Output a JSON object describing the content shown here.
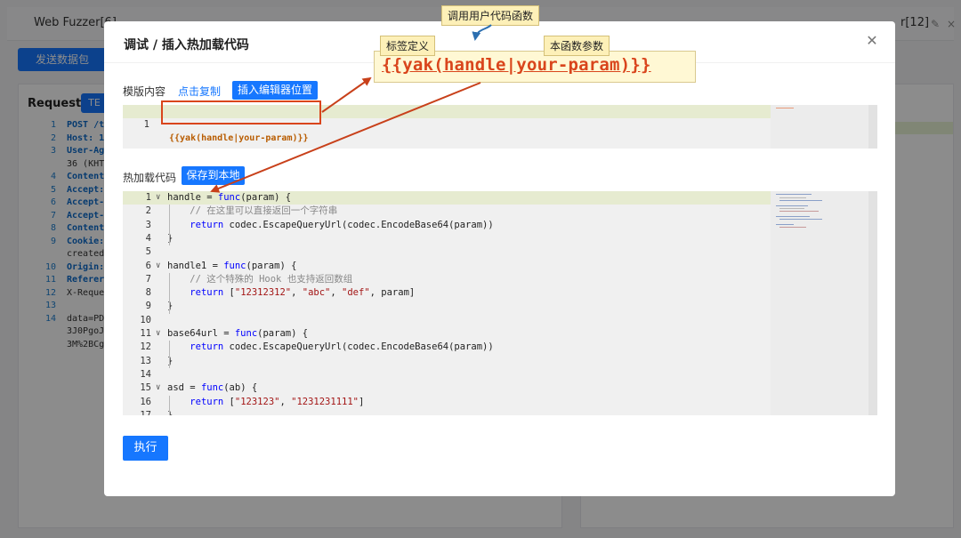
{
  "background": {
    "tabs": [
      {
        "label": "Web Fuzzer[6]"
      },
      {
        "label": "r[12]"
      }
    ],
    "send_button": "发送数据包",
    "request_label": "Request",
    "request_tab": "TE",
    "request_lines": [
      {
        "n": "1",
        "t": "POST /t",
        "kw": true
      },
      {
        "n": "2",
        "t": "Host: 1",
        "kw": true
      },
      {
        "n": "3",
        "t": "User-Ag",
        "kw": true
      },
      {
        "n": "",
        "t": "36 (KHT",
        "kw": false
      },
      {
        "n": "4",
        "t": "Content",
        "kw": true
      },
      {
        "n": "5",
        "t": "Accept:",
        "kw": true
      },
      {
        "n": "6",
        "t": "Accept-",
        "kw": true
      },
      {
        "n": "7",
        "t": "Accept-",
        "kw": true
      },
      {
        "n": "8",
        "t": "Content",
        "kw": true
      },
      {
        "n": "9",
        "t": "Cookie:",
        "kw": true
      },
      {
        "n": "",
        "t": "created",
        "kw": false
      },
      {
        "n": "10",
        "t": "Origin:",
        "kw": true
      },
      {
        "n": "11",
        "t": "Referer",
        "kw": true
      },
      {
        "n": "12",
        "t": "X-Reque",
        "kw": false
      },
      {
        "n": "13",
        "t": "",
        "kw": false
      },
      {
        "n": "14",
        "t": "data=PD",
        "kw": false
      },
      {
        "n": "",
        "t": "3J0PgoJ",
        "kw": false
      },
      {
        "n": "",
        "t": "3M%2BCg",
        "kw": false
      }
    ]
  },
  "modal": {
    "title": "调试 / 插入热加载代码",
    "template_label": "模版内容",
    "copy_link": "点击复制",
    "insert_button": "插入编辑器位置",
    "template_code": "{{yak(handle|your-param)}}",
    "template_line_no": "1",
    "hot_label": "热加载代码",
    "save_button": "保存到本地",
    "run_button": "执行",
    "close_symbol": "✕",
    "code_lines": [
      {
        "n": "1",
        "fold": true,
        "parts": [
          [
            "",
            "handle = "
          ],
          [
            "kw",
            "func"
          ],
          [
            "",
            "(param) {"
          ]
        ]
      },
      {
        "n": "2",
        "fold": false,
        "parts": [
          [
            "",
            "    "
          ],
          [
            "cm",
            "// 在这里可以直接返回一个字符串"
          ]
        ]
      },
      {
        "n": "3",
        "fold": false,
        "parts": [
          [
            "",
            "    "
          ],
          [
            "kw",
            "return"
          ],
          [
            "",
            " codec.EscapeQueryUrl(codec.EncodeBase64(param))"
          ]
        ]
      },
      {
        "n": "4",
        "fold": false,
        "parts": [
          [
            "",
            "}"
          ]
        ]
      },
      {
        "n": "5",
        "fold": false,
        "parts": [
          [
            "",
            ""
          ]
        ]
      },
      {
        "n": "6",
        "fold": true,
        "parts": [
          [
            "",
            "handle1 = "
          ],
          [
            "kw",
            "func"
          ],
          [
            "",
            "(param) {"
          ]
        ]
      },
      {
        "n": "7",
        "fold": false,
        "parts": [
          [
            "",
            "    "
          ],
          [
            "cm",
            "// 这个特殊的 Hook 也支持返回数组"
          ]
        ]
      },
      {
        "n": "8",
        "fold": false,
        "parts": [
          [
            "",
            "    "
          ],
          [
            "kw",
            "return"
          ],
          [
            "",
            " ["
          ],
          [
            "str",
            "\"12312312\""
          ],
          [
            "",
            ", "
          ],
          [
            "str",
            "\"abc\""
          ],
          [
            "",
            ", "
          ],
          [
            "str",
            "\"def\""
          ],
          [
            "",
            ", param]"
          ]
        ]
      },
      {
        "n": "9",
        "fold": false,
        "parts": [
          [
            "",
            "}"
          ]
        ]
      },
      {
        "n": "10",
        "fold": false,
        "parts": [
          [
            "",
            ""
          ]
        ]
      },
      {
        "n": "11",
        "fold": true,
        "parts": [
          [
            "",
            "base64url = "
          ],
          [
            "kw",
            "func"
          ],
          [
            "",
            "(param) {"
          ]
        ]
      },
      {
        "n": "12",
        "fold": false,
        "parts": [
          [
            "",
            "    "
          ],
          [
            "kw",
            "return"
          ],
          [
            "",
            " codec.EscapeQueryUrl(codec.EncodeBase64(param))"
          ]
        ]
      },
      {
        "n": "13",
        "fold": false,
        "parts": [
          [
            "",
            "}"
          ]
        ]
      },
      {
        "n": "14",
        "fold": false,
        "parts": [
          [
            "",
            ""
          ]
        ]
      },
      {
        "n": "15",
        "fold": true,
        "parts": [
          [
            "",
            "asd = "
          ],
          [
            "kw",
            "func"
          ],
          [
            "",
            "(ab) {"
          ]
        ]
      },
      {
        "n": "16",
        "fold": false,
        "parts": [
          [
            "",
            "    "
          ],
          [
            "kw",
            "return"
          ],
          [
            "",
            " ["
          ],
          [
            "str",
            "\"123123\""
          ],
          [
            "",
            ", "
          ],
          [
            "str",
            "\"1231231111\""
          ],
          [
            "",
            "]"
          ]
        ]
      },
      {
        "n": "17",
        "fold": false,
        "parts": [
          [
            "",
            "}"
          ]
        ]
      }
    ]
  },
  "annotations": {
    "call_user_func": "调用用户代码函数",
    "tag_def": "标签定义",
    "func_param": "本函数参数",
    "big_code": "{{yak(handle|your-param)}}"
  },
  "colors": {
    "accent": "#1677ff",
    "annotation_red": "#d9451c",
    "highlight_line": "#e6ebd0"
  }
}
